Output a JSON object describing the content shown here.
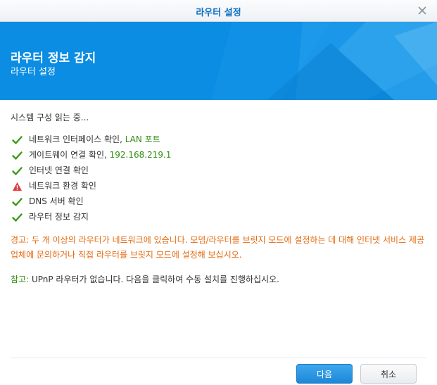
{
  "window": {
    "title": "라우터 설정"
  },
  "banner": {
    "title": "라우터 정보 감지",
    "subtitle": "라우터 설정"
  },
  "content": {
    "intro": "시스템 구성 읽는 중...",
    "checks": [
      {
        "icon": "check-icon",
        "text": "네트워크 인터페이스 확인, ",
        "highlight": "LAN 포트"
      },
      {
        "icon": "check-icon",
        "text": "게이트웨이 연결 확인, ",
        "highlight": "192.168.219.1"
      },
      {
        "icon": "check-icon",
        "text": "인터넷 연결 확인",
        "highlight": ""
      },
      {
        "icon": "warning-icon",
        "text": "네트워크 환경 확인",
        "highlight": ""
      },
      {
        "icon": "check-icon",
        "text": "DNS 서버 확인",
        "highlight": ""
      },
      {
        "icon": "check-icon",
        "text": "라우터 정보 감지",
        "highlight": ""
      }
    ],
    "warning": "경고: 두 개 이상의 라우터가 네트워크에 있습니다. 모뎀/라우터를 브릿지 모드에 설정하는 데 대해 인터넷 서비스 제공업체에 문의하거나 직접 라우터를 브릿지 모드에 설정해 보십시오.",
    "note_label": "참고:",
    "note_text": " UPnP 라우터가 없습니다. 다음을 클릭하여 수동 설치를 진행하십시오."
  },
  "buttons": {
    "next": "다음",
    "cancel": "취소"
  },
  "colors": {
    "accent": "#0a8de3",
    "success": "#2f8f0f",
    "warning": "#e46a10"
  }
}
